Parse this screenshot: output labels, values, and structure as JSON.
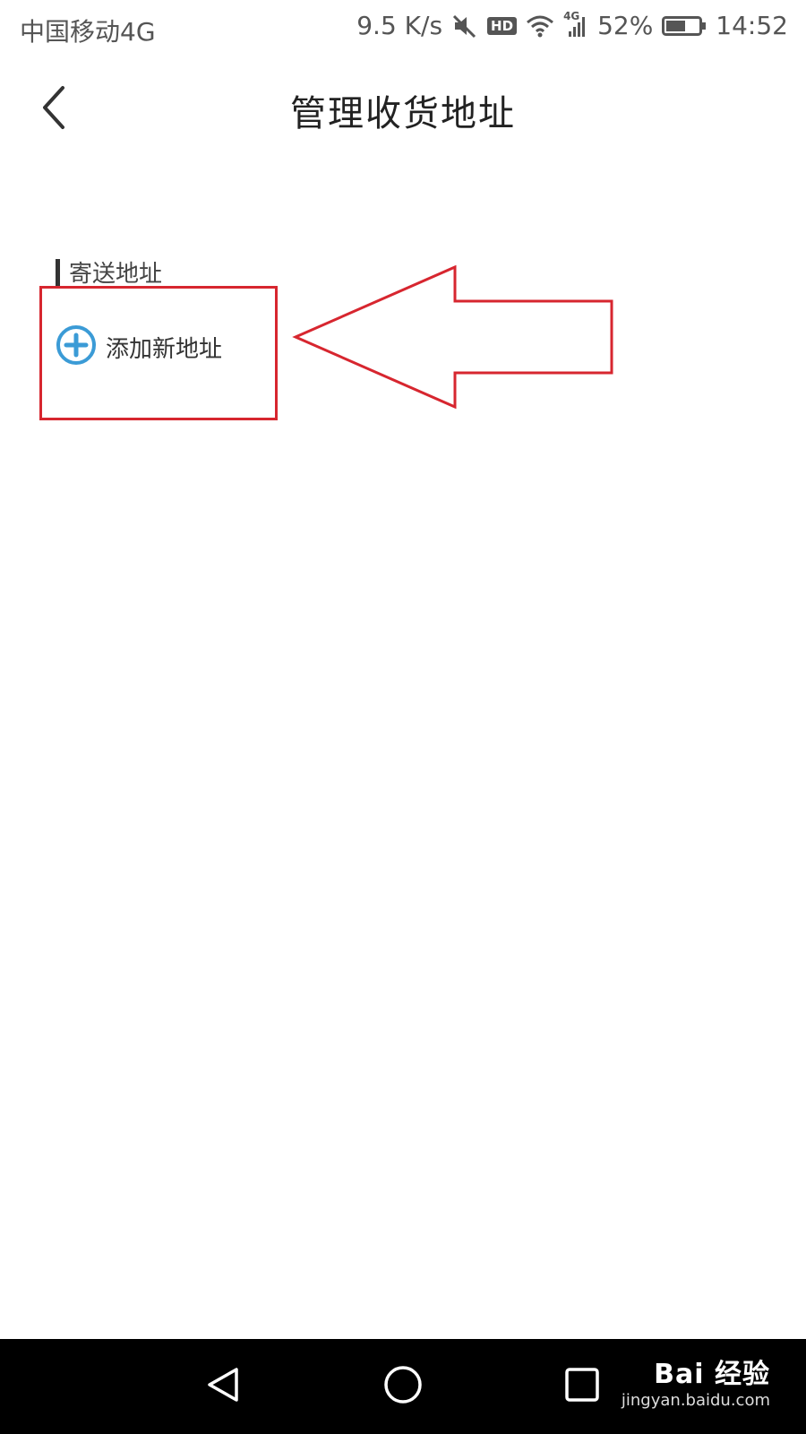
{
  "status_bar": {
    "carrier": "中国移动4G",
    "speed": "9.5 K/s",
    "hd": "HD",
    "network": "4G",
    "battery": "52%",
    "time": "14:52"
  },
  "header": {
    "title": "管理收货地址"
  },
  "section": {
    "label": "寄送地址",
    "add_label": "添加新地址"
  },
  "colors": {
    "accent": "#3b9bd6",
    "annotation": "#d7262f"
  },
  "watermark": {
    "main": "Bai 经验",
    "sub": "jingyan.baidu.com"
  },
  "icons": {
    "back": "chevron-left-icon",
    "add": "plus-circle-icon",
    "nav_back": "triangle-back-icon",
    "nav_home": "circle-home-icon",
    "nav_recent": "square-recent-icon"
  }
}
